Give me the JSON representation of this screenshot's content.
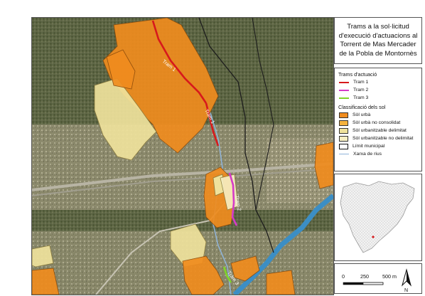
{
  "title": "Trams a la sol·licitud d'execució d'actuacions al Torrent de Mas Mercader de la Pobla de Montornès",
  "title_lines": [
    "Trams a la sol·licitud",
    "d'execució d'actuacions al",
    "Torrent de Mas Mercader",
    "de la Pobla de Montornès"
  ],
  "legend": {
    "trams_title": "Trams d'actuació",
    "trams": [
      {
        "label": "Tram 1",
        "color": "#d7191c"
      },
      {
        "label": "Tram 2",
        "color": "#d63bc8"
      },
      {
        "label": "Tram 3",
        "color": "#7fd62a"
      }
    ],
    "classes_title": "Classificació dels sol",
    "classes": [
      {
        "label": "Sòl urbà",
        "color": "#f08c1e"
      },
      {
        "label": "Sòl urbà no consolidat",
        "color": "#f5b23c"
      },
      {
        "label": "Sòl urbanitzable delimitat",
        "color": "#efe29c"
      },
      {
        "label": "Sòl urbanitzable no delimitat",
        "color": "#f7efc4"
      }
    ],
    "limit_label": "Límit municipal",
    "rivers_label": "Xarxa de rius",
    "rivers_color": "#8fb3d9"
  },
  "map_labels": {
    "tram1": "Tram 1",
    "tram2": "Tram 2",
    "tram3": "Tram 3"
  },
  "scale": {
    "ticks": [
      "0",
      "250",
      "500 m"
    ],
    "north": "N"
  }
}
